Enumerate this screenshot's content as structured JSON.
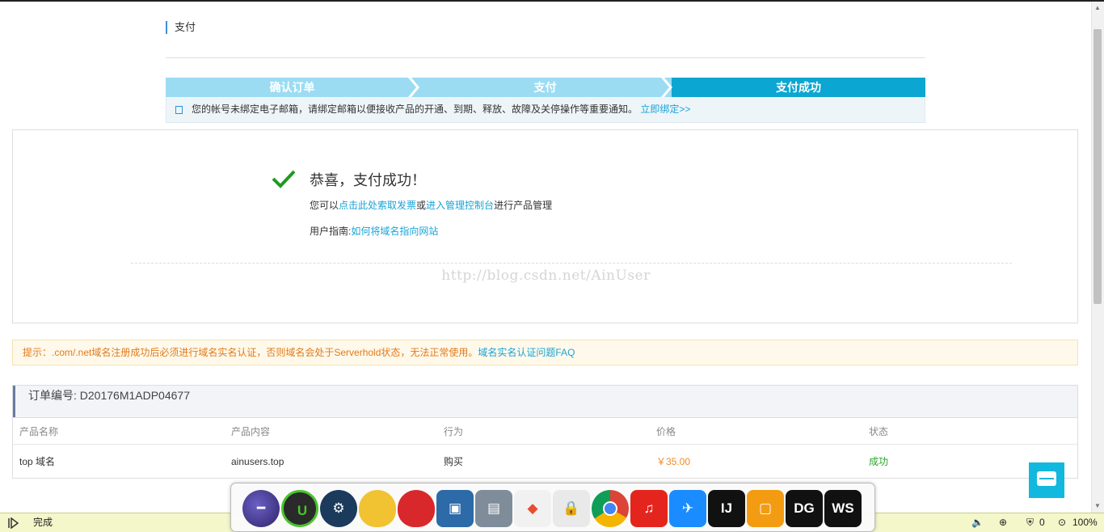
{
  "page": {
    "section_title": "支付"
  },
  "steps": [
    "确认订单",
    "支付",
    "支付成功"
  ],
  "notice": {
    "text": "您的帐号未绑定电子邮箱，请绑定邮箱以便接收产品的开通、到期、释放、故障及关停操作等重要通知。",
    "link": "立即绑定>>"
  },
  "success": {
    "title": "恭喜，支付成功！",
    "line1_prefix": "您可以",
    "line1_link1": "点击此处索取发票",
    "line1_mid": "或",
    "line1_link2": "进入管理控制台",
    "line1_suffix": "进行产品管理",
    "guide_prefix": "用户指南:",
    "guide_link": "如何将域名指向网站",
    "watermark": "http://blog.csdn.net/AinUser"
  },
  "tip": {
    "text": "提示：.com/.net域名注册成功后必须进行域名实名认证，否则域名会处于Serverhold状态，无法正常使用。",
    "link": "域名实名认证问题FAQ"
  },
  "order": {
    "number_label": "订单编号: D20176M1ADP04677",
    "headers": [
      "产品名称",
      "产品内容",
      "行为",
      "价格",
      "状态"
    ],
    "row": [
      "top 域名",
      "ainusers.top",
      "购买",
      "￥35.00",
      "成功"
    ]
  },
  "statusbar": {
    "text": "完成",
    "count": "0",
    "zoom": "100%"
  },
  "dock_icons": [
    "eclipse-icon",
    "iobit-icon",
    "steam-icon",
    "yellow-app-icon",
    "red-app-icon",
    "virtualbox-icon",
    "control-panel-icon",
    "git-icon",
    "lock-download-icon",
    "chrome-icon",
    "netease-music-icon",
    "dingtalk-icon",
    "intellij-icon",
    "vmware-icon",
    "datagrip-icon",
    "webstorm-icon"
  ],
  "colors": {
    "accent": "#1aa3d7",
    "step_active": "#0ba6d1",
    "step_inactive": "#9bdcf3",
    "success": "#2aa32a",
    "price": "#f08a22"
  }
}
